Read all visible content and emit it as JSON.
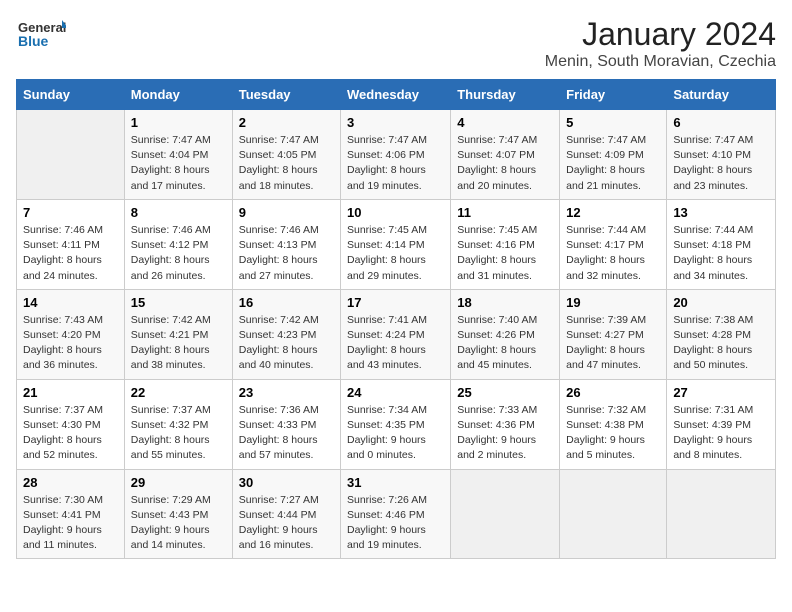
{
  "logo": {
    "general": "General",
    "blue": "Blue"
  },
  "header": {
    "month_title": "January 2024",
    "location": "Menin, South Moravian, Czechia"
  },
  "weekdays": [
    "Sunday",
    "Monday",
    "Tuesday",
    "Wednesday",
    "Thursday",
    "Friday",
    "Saturday"
  ],
  "weeks": [
    [
      {
        "day": "",
        "sunrise": "",
        "sunset": "",
        "daylight": ""
      },
      {
        "day": "1",
        "sunrise": "Sunrise: 7:47 AM",
        "sunset": "Sunset: 4:04 PM",
        "daylight": "Daylight: 8 hours and 17 minutes."
      },
      {
        "day": "2",
        "sunrise": "Sunrise: 7:47 AM",
        "sunset": "Sunset: 4:05 PM",
        "daylight": "Daylight: 8 hours and 18 minutes."
      },
      {
        "day": "3",
        "sunrise": "Sunrise: 7:47 AM",
        "sunset": "Sunset: 4:06 PM",
        "daylight": "Daylight: 8 hours and 19 minutes."
      },
      {
        "day": "4",
        "sunrise": "Sunrise: 7:47 AM",
        "sunset": "Sunset: 4:07 PM",
        "daylight": "Daylight: 8 hours and 20 minutes."
      },
      {
        "day": "5",
        "sunrise": "Sunrise: 7:47 AM",
        "sunset": "Sunset: 4:09 PM",
        "daylight": "Daylight: 8 hours and 21 minutes."
      },
      {
        "day": "6",
        "sunrise": "Sunrise: 7:47 AM",
        "sunset": "Sunset: 4:10 PM",
        "daylight": "Daylight: 8 hours and 23 minutes."
      }
    ],
    [
      {
        "day": "7",
        "sunrise": "Sunrise: 7:46 AM",
        "sunset": "Sunset: 4:11 PM",
        "daylight": "Daylight: 8 hours and 24 minutes."
      },
      {
        "day": "8",
        "sunrise": "Sunrise: 7:46 AM",
        "sunset": "Sunset: 4:12 PM",
        "daylight": "Daylight: 8 hours and 26 minutes."
      },
      {
        "day": "9",
        "sunrise": "Sunrise: 7:46 AM",
        "sunset": "Sunset: 4:13 PM",
        "daylight": "Daylight: 8 hours and 27 minutes."
      },
      {
        "day": "10",
        "sunrise": "Sunrise: 7:45 AM",
        "sunset": "Sunset: 4:14 PM",
        "daylight": "Daylight: 8 hours and 29 minutes."
      },
      {
        "day": "11",
        "sunrise": "Sunrise: 7:45 AM",
        "sunset": "Sunset: 4:16 PM",
        "daylight": "Daylight: 8 hours and 31 minutes."
      },
      {
        "day": "12",
        "sunrise": "Sunrise: 7:44 AM",
        "sunset": "Sunset: 4:17 PM",
        "daylight": "Daylight: 8 hours and 32 minutes."
      },
      {
        "day": "13",
        "sunrise": "Sunrise: 7:44 AM",
        "sunset": "Sunset: 4:18 PM",
        "daylight": "Daylight: 8 hours and 34 minutes."
      }
    ],
    [
      {
        "day": "14",
        "sunrise": "Sunrise: 7:43 AM",
        "sunset": "Sunset: 4:20 PM",
        "daylight": "Daylight: 8 hours and 36 minutes."
      },
      {
        "day": "15",
        "sunrise": "Sunrise: 7:42 AM",
        "sunset": "Sunset: 4:21 PM",
        "daylight": "Daylight: 8 hours and 38 minutes."
      },
      {
        "day": "16",
        "sunrise": "Sunrise: 7:42 AM",
        "sunset": "Sunset: 4:23 PM",
        "daylight": "Daylight: 8 hours and 40 minutes."
      },
      {
        "day": "17",
        "sunrise": "Sunrise: 7:41 AM",
        "sunset": "Sunset: 4:24 PM",
        "daylight": "Daylight: 8 hours and 43 minutes."
      },
      {
        "day": "18",
        "sunrise": "Sunrise: 7:40 AM",
        "sunset": "Sunset: 4:26 PM",
        "daylight": "Daylight: 8 hours and 45 minutes."
      },
      {
        "day": "19",
        "sunrise": "Sunrise: 7:39 AM",
        "sunset": "Sunset: 4:27 PM",
        "daylight": "Daylight: 8 hours and 47 minutes."
      },
      {
        "day": "20",
        "sunrise": "Sunrise: 7:38 AM",
        "sunset": "Sunset: 4:28 PM",
        "daylight": "Daylight: 8 hours and 50 minutes."
      }
    ],
    [
      {
        "day": "21",
        "sunrise": "Sunrise: 7:37 AM",
        "sunset": "Sunset: 4:30 PM",
        "daylight": "Daylight: 8 hours and 52 minutes."
      },
      {
        "day": "22",
        "sunrise": "Sunrise: 7:37 AM",
        "sunset": "Sunset: 4:32 PM",
        "daylight": "Daylight: 8 hours and 55 minutes."
      },
      {
        "day": "23",
        "sunrise": "Sunrise: 7:36 AM",
        "sunset": "Sunset: 4:33 PM",
        "daylight": "Daylight: 8 hours and 57 minutes."
      },
      {
        "day": "24",
        "sunrise": "Sunrise: 7:34 AM",
        "sunset": "Sunset: 4:35 PM",
        "daylight": "Daylight: 9 hours and 0 minutes."
      },
      {
        "day": "25",
        "sunrise": "Sunrise: 7:33 AM",
        "sunset": "Sunset: 4:36 PM",
        "daylight": "Daylight: 9 hours and 2 minutes."
      },
      {
        "day": "26",
        "sunrise": "Sunrise: 7:32 AM",
        "sunset": "Sunset: 4:38 PM",
        "daylight": "Daylight: 9 hours and 5 minutes."
      },
      {
        "day": "27",
        "sunrise": "Sunrise: 7:31 AM",
        "sunset": "Sunset: 4:39 PM",
        "daylight": "Daylight: 9 hours and 8 minutes."
      }
    ],
    [
      {
        "day": "28",
        "sunrise": "Sunrise: 7:30 AM",
        "sunset": "Sunset: 4:41 PM",
        "daylight": "Daylight: 9 hours and 11 minutes."
      },
      {
        "day": "29",
        "sunrise": "Sunrise: 7:29 AM",
        "sunset": "Sunset: 4:43 PM",
        "daylight": "Daylight: 9 hours and 14 minutes."
      },
      {
        "day": "30",
        "sunrise": "Sunrise: 7:27 AM",
        "sunset": "Sunset: 4:44 PM",
        "daylight": "Daylight: 9 hours and 16 minutes."
      },
      {
        "day": "31",
        "sunrise": "Sunrise: 7:26 AM",
        "sunset": "Sunset: 4:46 PM",
        "daylight": "Daylight: 9 hours and 19 minutes."
      },
      {
        "day": "",
        "sunrise": "",
        "sunset": "",
        "daylight": ""
      },
      {
        "day": "",
        "sunrise": "",
        "sunset": "",
        "daylight": ""
      },
      {
        "day": "",
        "sunrise": "",
        "sunset": "",
        "daylight": ""
      }
    ]
  ]
}
